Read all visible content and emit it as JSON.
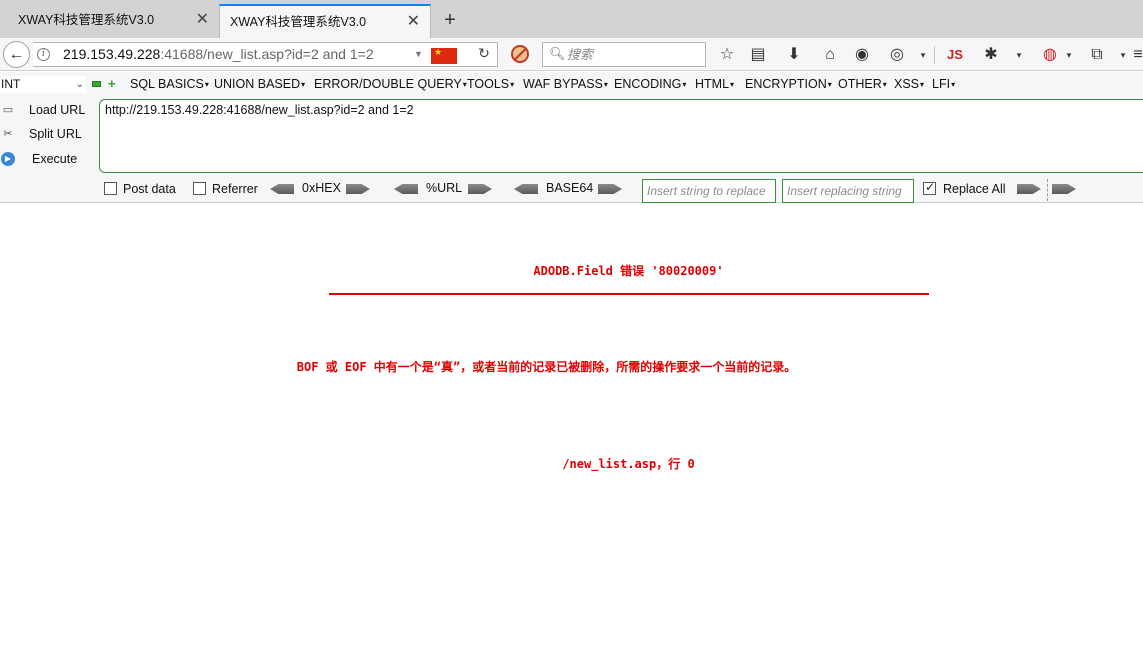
{
  "browser": {
    "tabs": [
      {
        "title": "XWAY科技管理系统V3.0",
        "active": false
      },
      {
        "title": "XWAY科技管理系统V3.0",
        "active": true
      }
    ],
    "url_host": "219.153.49.228",
    "url_rest": ":41688/new_list.asp?id=2 and 1=2",
    "search_placeholder": "搜索",
    "js_label": "JS"
  },
  "hackbar": {
    "mode": "INT",
    "menu": [
      "SQL BASICS",
      "UNION BASED",
      "ERROR/DOUBLE QUERY",
      "TOOLS",
      "WAF BYPASS",
      "ENCODING",
      "HTML",
      "ENCRYPTION",
      "OTHER",
      "XSS",
      "LFI"
    ],
    "buttons": {
      "load": "Load URL",
      "split": "Split URL",
      "execute": "Execute"
    },
    "url_value": "http://219.153.49.228:41688/new_list.asp?id=2 and 1=2",
    "options": {
      "post_data": "Post data",
      "referrer": "Referrer",
      "hex": "0xHEX",
      "urlenc": "%URL",
      "base64": "BASE64",
      "replace_placeholder": "Insert string to replace",
      "replacing_placeholder": "Insert replacing string",
      "replace_all": "Replace All"
    }
  },
  "page": {
    "error_title": "ADODB.Field 错误 '80020009'",
    "error_desc": "BOF 或 EOF 中有一个是“真”，或者当前的记录已被删除，所需的操作要求一个当前的记录。",
    "error_location": "/new_list.asp，行 0"
  },
  "colors": {
    "error": "#e00000",
    "accent": "#0a84ff",
    "hackbar_green": "#3a8f3a"
  }
}
